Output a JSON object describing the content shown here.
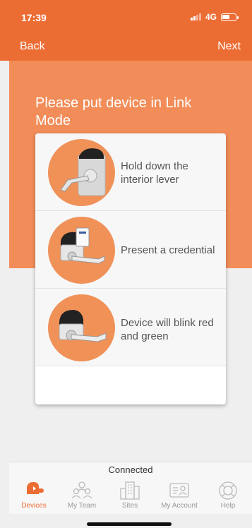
{
  "status": {
    "time": "17:39",
    "network": "4G"
  },
  "nav": {
    "back_label": "Back",
    "next_label": "Next"
  },
  "hero": {
    "title": "Please put device in Link Mode"
  },
  "steps": [
    {
      "text": "Hold down the interior lever",
      "icon": "lever-lock-icon"
    },
    {
      "text": "Present a credential",
      "icon": "credential-lock-icon"
    },
    {
      "text": "Device will blink red and green",
      "icon": "blink-lock-icon"
    }
  ],
  "connection": {
    "status": "Connected"
  },
  "tabs": [
    {
      "label": "Devices",
      "icon": "devices-icon",
      "active": true
    },
    {
      "label": "My Team",
      "icon": "team-icon",
      "active": false
    },
    {
      "label": "Sites",
      "icon": "sites-icon",
      "active": false
    },
    {
      "label": "My Account",
      "icon": "account-icon",
      "active": false
    },
    {
      "label": "Help",
      "icon": "help-icon",
      "active": false
    }
  ],
  "colors": {
    "accent": "#ec6d34",
    "hero": "#f28d59",
    "inactive_tab": "#999999"
  }
}
